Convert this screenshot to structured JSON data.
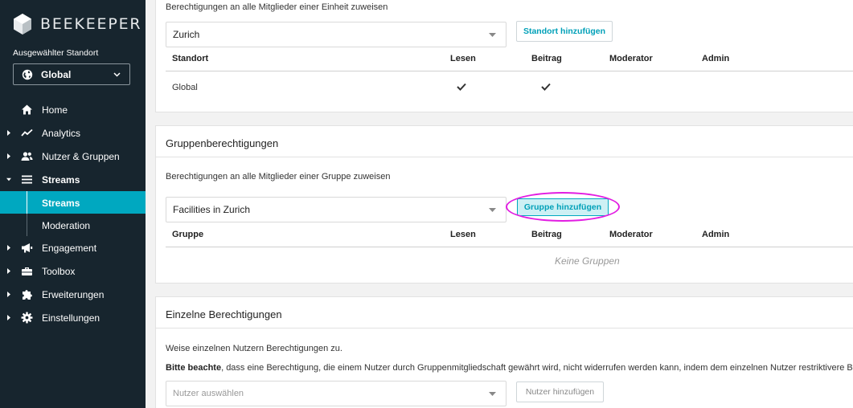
{
  "sidebar": {
    "brand": "BEEKEEPER",
    "location_label": "Ausgewählter Standort",
    "location_value": "Global",
    "nav": [
      {
        "label": "Home",
        "icon": "home-icon"
      },
      {
        "label": "Analytics",
        "icon": "analytics-icon"
      },
      {
        "label": "Nutzer & Gruppen",
        "icon": "users-icon"
      },
      {
        "label": "Streams",
        "icon": "streams-icon"
      },
      {
        "label": "Engagement",
        "icon": "megaphone-icon"
      },
      {
        "label": "Toolbox",
        "icon": "toolbox-icon"
      },
      {
        "label": "Erweiterungen",
        "icon": "puzzle-icon"
      },
      {
        "label": "Einstellungen",
        "icon": "gear-icon"
      }
    ],
    "streams_sub": [
      {
        "label": "Streams",
        "active": true
      },
      {
        "label": "Moderation",
        "active": false
      }
    ],
    "colors": {
      "background": "#17252e",
      "active": "#00a8c0"
    }
  },
  "location_section": {
    "description": "Berechtigungen an alle Mitglieder einer Einheit zuweisen",
    "select_value": "Zurich",
    "add_button": "Standort hinzufügen",
    "columns": [
      "Standort",
      "Lesen",
      "Beitrag",
      "Moderator",
      "Admin"
    ],
    "rows": [
      {
        "name": "Global",
        "lesen": true,
        "beitrag": true,
        "moderator": false,
        "admin": false
      }
    ]
  },
  "group_section": {
    "title": "Gruppenberechtigungen",
    "description": "Berechtigungen an alle Mitglieder einer Gruppe zuweisen",
    "select_value": "Facilities in Zurich",
    "add_button": "Gruppe hinzufügen",
    "columns": [
      "Gruppe",
      "Lesen",
      "Beitrag",
      "Moderator",
      "Admin"
    ],
    "empty_text": "Keine Gruppen"
  },
  "individual_section": {
    "title": "Einzelne Berechtigungen",
    "description": "Weise einzelnen Nutzern Berechtigungen zu.",
    "note_bold": "Bitte beachte",
    "note_text": ", dass eine Berechtigung, die einem Nutzer durch Gruppenmitgliedschaft gewährt wird, nicht widerrufen werden kann, indem dem einzelnen Nutzer restriktivere Be",
    "select_placeholder": "Nutzer auswählen",
    "add_button": "Nutzer hinzufügen"
  },
  "accent_color": "#00a0b8",
  "highlight_color": "#e21de2"
}
